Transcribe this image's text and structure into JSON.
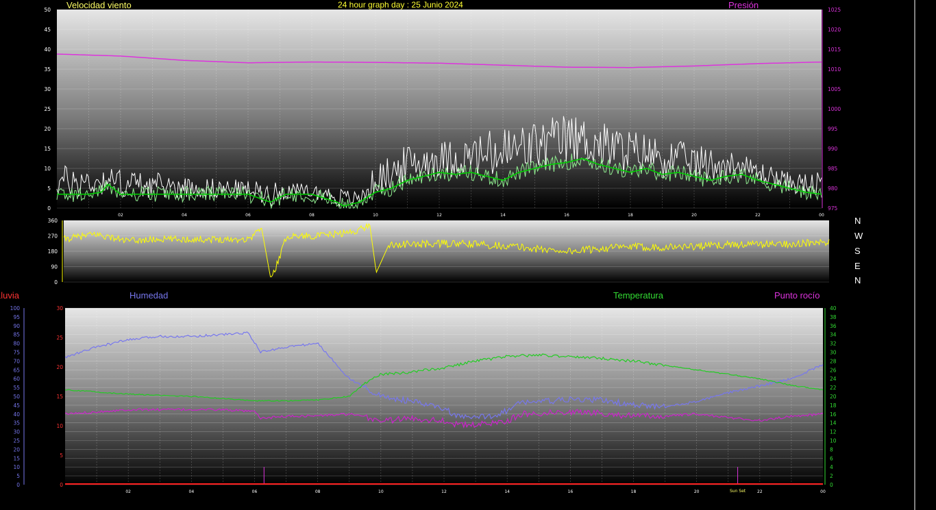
{
  "header": {
    "wind_title": "Velocidad viento",
    "graph_title": "24 hour graph day : 25 Junio 2024",
    "pressure_title": "Presión"
  },
  "lower_header": {
    "rain": "Lluvia",
    "humidity": "Humedad",
    "temperature": "Temperatura",
    "dewpoint": "Punto rocío"
  },
  "compass": [
    "N",
    "W",
    "S",
    "E",
    "N"
  ],
  "colors": {
    "wind_gust": "#ffffff",
    "wind_avg": "#90ee90",
    "wind_avg10": "#00cc00",
    "pressure": "#dd33dd",
    "direction": "#ffff00",
    "humidity": "#7777ee",
    "temperature": "#22cc22",
    "dewpoint": "#cc22cc",
    "rain": "#ff2222",
    "title_yellow": "#ffff66"
  },
  "x_ticks": [
    "02",
    "04",
    "06",
    "08",
    "10",
    "12",
    "14",
    "16",
    "18",
    "20",
    "22",
    "00"
  ],
  "sunset_label": "Sun Set",
  "chart_data": [
    {
      "type": "line",
      "name": "wind_pressure",
      "x_unit": "hour",
      "ylim": [
        0,
        50
      ],
      "y_ticks": [
        0,
        5,
        10,
        15,
        20,
        25,
        30,
        35,
        40,
        45,
        50
      ],
      "y2lim": [
        975,
        1025
      ],
      "y2_ticks": [
        975,
        980,
        985,
        990,
        995,
        1000,
        1005,
        1010,
        1015,
        1020,
        1025
      ],
      "pressure": {
        "x": [
          0,
          2,
          4,
          6,
          8,
          10,
          12,
          14,
          16,
          18,
          20,
          22,
          24
        ],
        "y": [
          1013.8,
          1013.3,
          1012.2,
          1011.6,
          1011.8,
          1011.7,
          1011.5,
          1011.0,
          1010.5,
          1010.4,
          1010.8,
          1011.4,
          1011.8
        ]
      },
      "wind_avg10": {
        "x": [
          0,
          1,
          1.4,
          1.6,
          2,
          4,
          5.5,
          6,
          6.7,
          7.2,
          8,
          8.8,
          9,
          9.5,
          10,
          10.5,
          11,
          11.5,
          12,
          12.5,
          13,
          13.5,
          14,
          14.5,
          15,
          15.5,
          16,
          16.5,
          17,
          17.5,
          18,
          18.5,
          19,
          19.5,
          20,
          20.5,
          21,
          21.5,
          22,
          22.5,
          23,
          23.5,
          24
        ],
        "y": [
          3.5,
          3.5,
          4,
          6,
          3.5,
          3.5,
          3.5,
          3.5,
          1.5,
          3.5,
          3.5,
          1.5,
          0.5,
          1.5,
          4,
          5,
          7,
          8,
          9,
          8.5,
          9,
          8,
          7,
          9,
          10,
          11,
          11.5,
          12.5,
          11,
          10,
          9,
          10,
          8.5,
          9,
          8,
          7,
          8,
          8.5,
          7,
          6,
          5,
          4,
          3.5
        ]
      },
      "gust_envelope": {
        "x": [
          0,
          2,
          4,
          6,
          8,
          9,
          9.5,
          10,
          11,
          12,
          13,
          14,
          15,
          16,
          17,
          18,
          19,
          20,
          21,
          22,
          23,
          24
        ],
        "y": [
          10,
          9,
          7,
          6,
          5,
          4,
          3,
          10,
          15,
          16,
          17,
          20,
          21,
          23,
          21,
          19,
          17,
          15,
          14,
          11,
          8,
          8
        ]
      }
    },
    {
      "type": "line",
      "name": "wind_direction",
      "x_unit": "hour",
      "ylim": [
        0,
        360
      ],
      "y_ticks": [
        0,
        90,
        180,
        270,
        360
      ],
      "direction": {
        "x": [
          0,
          1,
          2,
          3,
          4,
          5,
          5.8,
          6.2,
          6.5,
          7,
          8,
          9,
          9.6,
          9.8,
          10.2,
          11,
          12,
          13,
          14,
          15,
          16,
          17,
          18,
          19,
          20,
          21,
          22,
          23,
          24
        ],
        "y": [
          250,
          280,
          240,
          250,
          250,
          250,
          250,
          320,
          10,
          270,
          270,
          290,
          330,
          55,
          220,
          220,
          225,
          220,
          210,
          190,
          180,
          200,
          205,
          205,
          210,
          220,
          220,
          225,
          230
        ]
      }
    },
    {
      "type": "line",
      "name": "temp_humidity",
      "x_unit": "hour",
      "y_left_rain": [
        0,
        5,
        10,
        15,
        20,
        25,
        30
      ],
      "rain_ylim": [
        0,
        30
      ],
      "humidity_ylim": [
        0,
        100
      ],
      "humidity_ticks": [
        0,
        5,
        10,
        15,
        20,
        25,
        30,
        35,
        40,
        45,
        50,
        55,
        60,
        65,
        70,
        75,
        80,
        85,
        90,
        95,
        100
      ],
      "temp_ylim": [
        0,
        40
      ],
      "temp_ticks": [
        0,
        2,
        4,
        6,
        8,
        10,
        12,
        14,
        16,
        18,
        20,
        22,
        24,
        26,
        28,
        30,
        32,
        34,
        36,
        38,
        40
      ],
      "humidity": {
        "x": [
          0,
          1,
          2,
          3,
          4,
          5,
          5.8,
          6.2,
          7,
          8,
          8.5,
          9,
          9.5,
          10,
          11,
          12,
          12.5,
          13,
          13.5,
          14,
          14.5,
          15,
          16,
          17,
          18,
          19,
          20,
          21,
          22,
          23,
          24
        ],
        "y": [
          72,
          78,
          82,
          84,
          84,
          85,
          86,
          75,
          78,
          80,
          70,
          60,
          55,
          50,
          47,
          43,
          38,
          38,
          39,
          42,
          47,
          47,
          48,
          48,
          45,
          44,
          47,
          52,
          56,
          60,
          68
        ]
      },
      "temperature": {
        "x": [
          0,
          1,
          2,
          3,
          4,
          5,
          6,
          7,
          8,
          9,
          9.5,
          10,
          11,
          12,
          13,
          14,
          15,
          16,
          17,
          18,
          19,
          20,
          21,
          22,
          23,
          24
        ],
        "y": [
          21.5,
          21,
          20.5,
          20.2,
          20,
          19.5,
          19,
          19,
          19.2,
          20,
          23,
          25,
          25.5,
          26.5,
          28,
          29,
          29.4,
          29,
          28.6,
          28,
          27,
          26,
          25,
          24,
          22.5,
          21.5
        ]
      },
      "dewpoint": {
        "x": [
          0,
          1,
          2,
          3,
          4,
          5,
          6,
          6.2,
          7,
          8,
          9,
          10,
          11,
          12,
          12.5,
          13,
          14,
          14.5,
          15,
          16,
          17,
          18,
          19,
          20,
          21,
          22,
          23,
          24
        ],
        "y": [
          16,
          16.5,
          17,
          17,
          17,
          17,
          16.5,
          15,
          15.5,
          15.6,
          16,
          14.5,
          15,
          14.5,
          13.5,
          13.5,
          14.5,
          16,
          16.2,
          16.5,
          16.2,
          15.5,
          15.5,
          16,
          15.2,
          14.5,
          15.5,
          16
        ]
      },
      "rain": {
        "x": [
          0,
          24
        ],
        "y": [
          0,
          0
        ]
      }
    }
  ]
}
